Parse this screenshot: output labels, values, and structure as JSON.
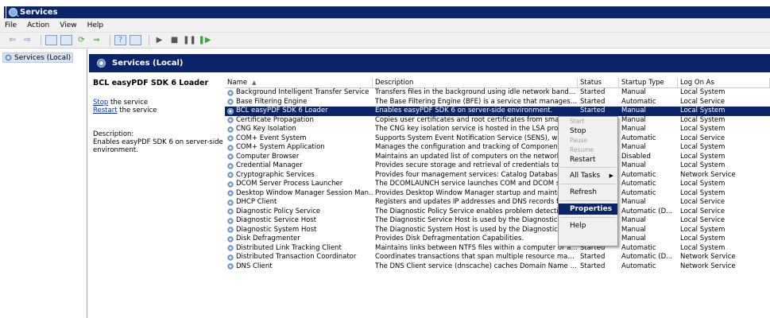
{
  "window": {
    "title": "Services"
  },
  "menu": [
    "File",
    "Action",
    "View",
    "Help"
  ],
  "tree": {
    "root": "Services (Local)"
  },
  "header": {
    "title": "Services (Local)"
  },
  "detail": {
    "service_name": "BCL easyPDF SDK 6 Loader",
    "stop_link": "Stop",
    "stop_suffix": " the service",
    "restart_link": "Restart",
    "restart_suffix": " the service",
    "description_label": "Description:",
    "description": "Enables easyPDF SDK 6 on server-side environment."
  },
  "columns": [
    "Name",
    "Description",
    "Status",
    "Startup Type",
    "Log On As"
  ],
  "rows": [
    [
      "Background Intelligent Transfer Service",
      "Transfers files in the background using idle network bandwi...",
      "Started",
      "Manual",
      "Local System"
    ],
    [
      "Base Filtering Engine",
      "The Base Filtering Engine (BFE) is a service that manages fir...",
      "Started",
      "Automatic",
      "Local Service"
    ],
    [
      "BCL easyPDF SDK 6 Loader",
      "Enables easyPDF SDK 6 on server-side environment.",
      "Started",
      "Manual",
      "Local System"
    ],
    [
      "Certificate Propagation",
      "Copies user certificates and root certificates from smart",
      "",
      "Manual",
      "Local System"
    ],
    [
      "CNG Key Isolation",
      "The CNG key isolation service is hosted in the LSA proce",
      "",
      "Manual",
      "Local System"
    ],
    [
      "COM+ Event System",
      "Supports System Event Notification Service (SENS), whi",
      "",
      "Automatic",
      "Local Service"
    ],
    [
      "COM+ System Application",
      "Manages the configuration and tracking of Component",
      "",
      "Manual",
      "Local System"
    ],
    [
      "Computer Browser",
      "Maintains an updated list of computers on the network",
      "",
      "Disabled",
      "Local System"
    ],
    [
      "Credential Manager",
      "Provides secure storage and retrieval of credentials to",
      "",
      "Manual",
      "Local System"
    ],
    [
      "Cryptographic Services",
      "Provides four management services: Catalog Database",
      "",
      "Automatic",
      "Network Service"
    ],
    [
      "DCOM Server Process Launcher",
      "The DCOMLAUNCH service launches COM and DCOM se",
      "",
      "Automatic",
      "Local System"
    ],
    [
      "Desktop Window Manager Session Man...",
      "Provides Desktop Window Manager startup and mainter",
      "",
      "Automatic",
      "Local System"
    ],
    [
      "DHCP Client",
      "Registers and updates IP addresses and DNS records fc",
      "",
      "Manual",
      "Local Service"
    ],
    [
      "Diagnostic Policy Service",
      "The Diagnostic Policy Service enables problem detection",
      "",
      "Automatic (D...",
      "Local Service"
    ],
    [
      "Diagnostic Service Host",
      "The Diagnostic Service Host is used by the Diagnostic Policy ...",
      "",
      "Manual",
      "Local Service"
    ],
    [
      "Diagnostic System Host",
      "The Diagnostic System Host is used by the Diagnostic Policy ...",
      "",
      "Manual",
      "Local System"
    ],
    [
      "Disk Defragmenter",
      "Provides Disk Defragmentation Capabilities.",
      "",
      "Manual",
      "Local System"
    ],
    [
      "Distributed Link Tracking Client",
      "Maintains links between NTFS files within a computer or acro...",
      "Started",
      "Automatic",
      "Local System"
    ],
    [
      "Distributed Transaction Coordinator",
      "Coordinates transactions that span multiple resource manag...",
      "Started",
      "Automatic (D...",
      "Network Service"
    ],
    [
      "DNS Client",
      "The DNS Client service (dnscache) caches Domain Name Sys...",
      "Started",
      "Automatic",
      "Network Service"
    ]
  ],
  "context_menu": {
    "start": "Start",
    "stop": "Stop",
    "pause": "Pause",
    "resume": "Resume",
    "restart": "Restart",
    "all_tasks": "All Tasks",
    "refresh": "Refresh",
    "properties": "Properties",
    "help": "Help"
  },
  "colors": {
    "accent": "#0a246a",
    "link": "#0033cc"
  }
}
